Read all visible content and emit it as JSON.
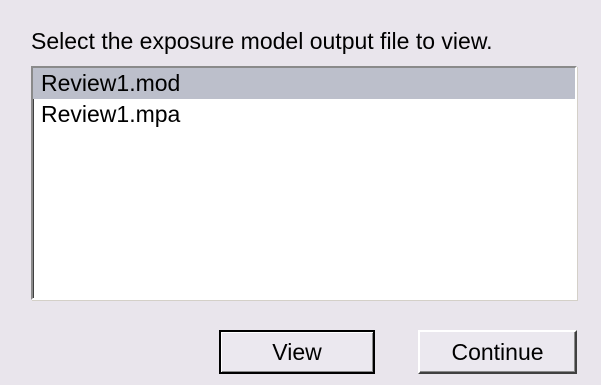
{
  "dialog": {
    "prompt": "Select the exposure model output file to view.",
    "files": [
      {
        "name": "Review1.mod",
        "selected": true
      },
      {
        "name": "Review1.mpa",
        "selected": false
      }
    ],
    "buttons": {
      "view_label": "View",
      "continue_label": "Continue"
    },
    "colors": {
      "background": "#e9e5ec",
      "selection": "#bcbfcb"
    }
  }
}
